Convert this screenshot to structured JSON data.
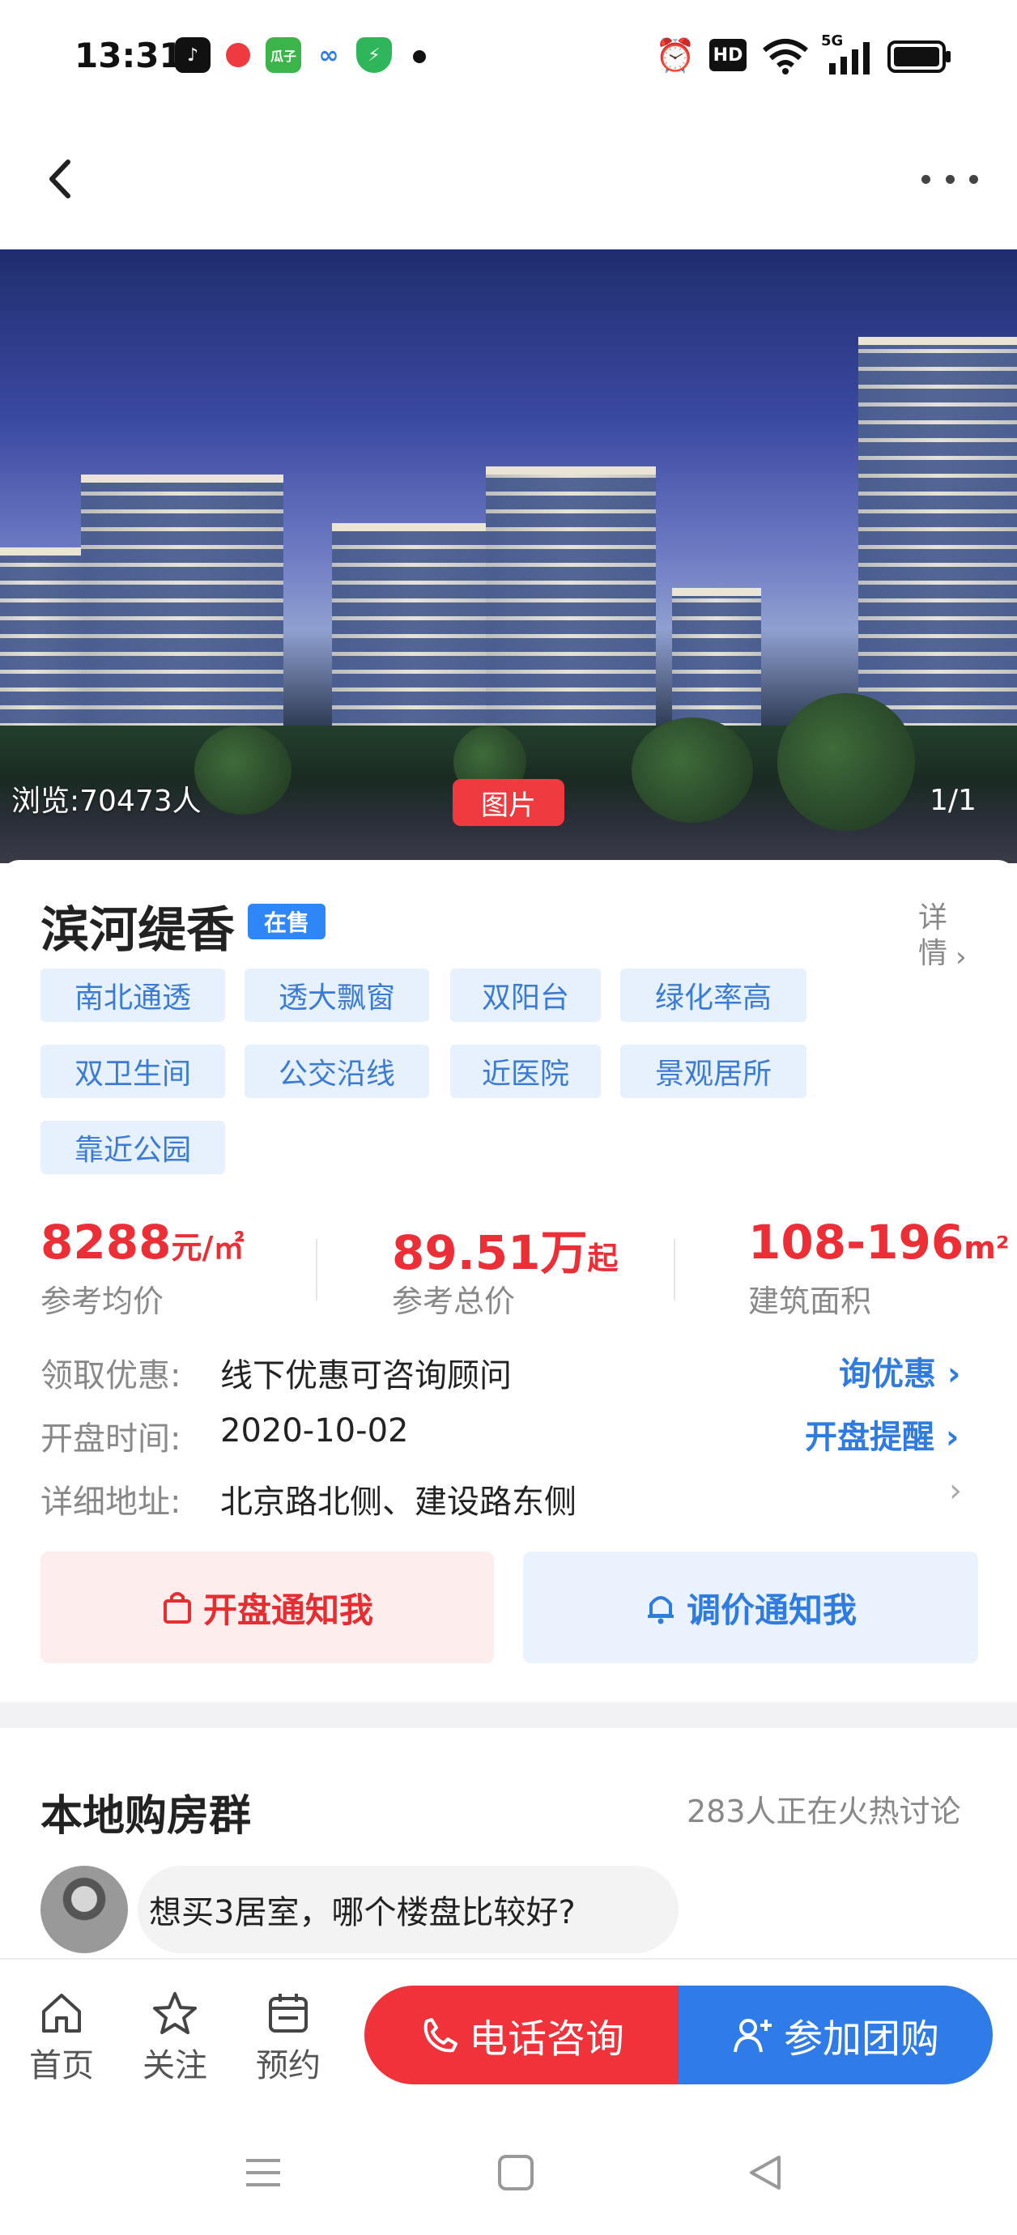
{
  "status_bar": {
    "time": "13:31",
    "hd": "HD",
    "net": "5G"
  },
  "hero": {
    "views": "浏览:70473人",
    "pic_label": "图片",
    "pager": "1/1"
  },
  "project": {
    "name": "滨河缇香",
    "status": "在售",
    "detail_label": "详情",
    "tags": [
      "南北通透",
      "透大飘窗",
      "双阳台",
      "绿化率高",
      "双卫生间",
      "公交沿线",
      "近医院",
      "景观居所",
      "靠近公园"
    ]
  },
  "stats": {
    "avg_price": "8288",
    "avg_price_unit": "元/㎡",
    "avg_price_label": "参考均价",
    "total_price": "89.51万",
    "total_price_unit": "起",
    "total_price_label": "参考总价",
    "area": "108-196",
    "area_unit": "m²",
    "area_label": "建筑面积"
  },
  "info": {
    "discount_label": "领取优惠:",
    "discount_value": "线下优惠可咨询顾问",
    "discount_link": "询优惠",
    "open_label": "开盘时间:",
    "open_value": "2020-10-02",
    "open_link": "开盘提醒",
    "address_label": "详细地址:",
    "address_value": "北京路北侧、建设路东侧"
  },
  "actions": {
    "notify_open": "开盘通知我",
    "notify_price": "调价通知我"
  },
  "group": {
    "title": "本地购房群",
    "count": "283人正在火热讨论",
    "message": "想买3居室，哪个楼盘比较好?"
  },
  "tabbar": {
    "home": "首页",
    "follow": "关注",
    "book": "预约",
    "call": "电话咨询",
    "join": "参加团购"
  }
}
